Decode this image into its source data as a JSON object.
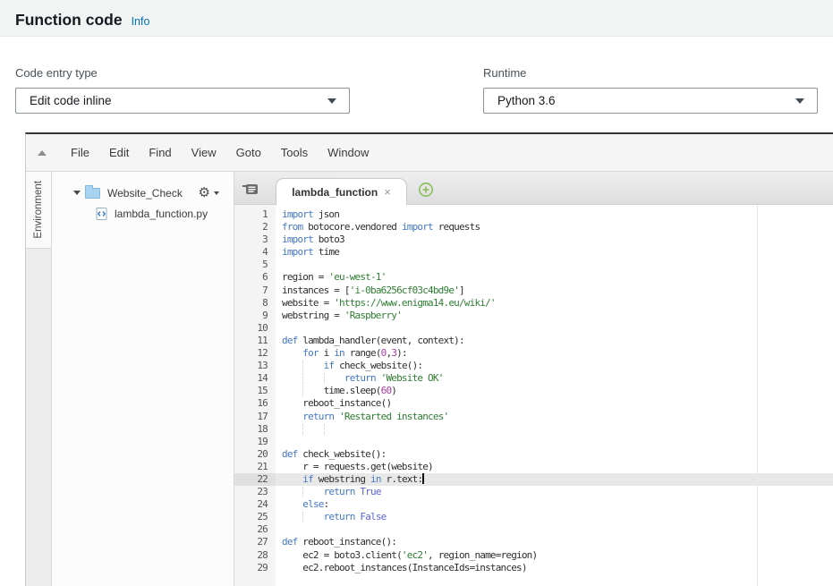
{
  "header": {
    "title": "Function code",
    "info": "Info"
  },
  "form": {
    "code_entry_label": "Code entry type",
    "code_entry_value": "Edit code inline",
    "runtime_label": "Runtime",
    "runtime_value": "Python 3.6"
  },
  "editor": {
    "menu": [
      "File",
      "Edit",
      "Find",
      "View",
      "Goto",
      "Tools",
      "Window"
    ],
    "sidebar_tab": "Environment",
    "tree": {
      "folder": "Website_Check",
      "file": "lambda_function.py"
    },
    "tab": {
      "title": "lambda_function",
      "close": "×"
    },
    "code": {
      "active_line": 22,
      "lines": [
        [
          [
            "k",
            "import"
          ],
          [
            "t",
            " json"
          ]
        ],
        [
          [
            "k",
            "from"
          ],
          [
            "t",
            " botocore.vendored "
          ],
          [
            "k",
            "import"
          ],
          [
            "t",
            " requests"
          ]
        ],
        [
          [
            "k",
            "import"
          ],
          [
            "t",
            " boto3"
          ]
        ],
        [
          [
            "k",
            "import"
          ],
          [
            "t",
            " time"
          ]
        ],
        [],
        [
          [
            "t",
            "region = "
          ],
          [
            "s",
            "'eu-west-1'"
          ]
        ],
        [
          [
            "t",
            "instances = ["
          ],
          [
            "s",
            "'i-0ba6256cf03c4bd9e'"
          ],
          [
            "t",
            "]"
          ]
        ],
        [
          [
            "t",
            "website = "
          ],
          [
            "s",
            "'https://www.enigma14.eu/wiki/'"
          ]
        ],
        [
          [
            "t",
            "webstring = "
          ],
          [
            "s",
            "'Raspberry'"
          ]
        ],
        [],
        [
          [
            "k",
            "def"
          ],
          [
            "t",
            " lambda_handler(event, context):"
          ]
        ],
        [
          [
            "t",
            "    "
          ],
          [
            "k",
            "for"
          ],
          [
            "t",
            " i "
          ],
          [
            "k",
            "in"
          ],
          [
            "t",
            " range("
          ],
          [
            "n",
            "0"
          ],
          [
            "t",
            ","
          ],
          [
            "n",
            "3"
          ],
          [
            "t",
            "):"
          ]
        ],
        [
          [
            "t",
            "        "
          ],
          [
            "k",
            "if"
          ],
          [
            "t",
            " check_website():"
          ]
        ],
        [
          [
            "t",
            "            "
          ],
          [
            "k",
            "return"
          ],
          [
            "t",
            " "
          ],
          [
            "s",
            "'Website OK'"
          ]
        ],
        [
          [
            "t",
            "        time.sleep("
          ],
          [
            "n",
            "60"
          ],
          [
            "t",
            ")"
          ]
        ],
        [
          [
            "t",
            "    reboot_instance()"
          ]
        ],
        [
          [
            "t",
            "    "
          ],
          [
            "k",
            "return"
          ],
          [
            "t",
            " "
          ],
          [
            "s",
            "'Restarted instances'"
          ]
        ],
        [
          [
            "t",
            "        "
          ]
        ],
        [],
        [
          [
            "k",
            "def"
          ],
          [
            "t",
            " check_website():"
          ]
        ],
        [
          [
            "t",
            "    r = requests.get(website)"
          ]
        ],
        [
          [
            "t",
            "    "
          ],
          [
            "k",
            "if"
          ],
          [
            "t",
            " webstring "
          ],
          [
            "k",
            "in"
          ],
          [
            "t",
            " r.text:"
          ]
        ],
        [
          [
            "t",
            "        "
          ],
          [
            "k",
            "return"
          ],
          [
            "t",
            " "
          ],
          [
            "c",
            "True"
          ]
        ],
        [
          [
            "t",
            "    "
          ],
          [
            "k",
            "else"
          ],
          [
            "t",
            ":"
          ]
        ],
        [
          [
            "t",
            "        "
          ],
          [
            "k",
            "return"
          ],
          [
            "t",
            " "
          ],
          [
            "c",
            "False"
          ]
        ],
        [],
        [
          [
            "k",
            "def"
          ],
          [
            "t",
            " reboot_instance():"
          ]
        ],
        [
          [
            "t",
            "    ec2 = boto3.client("
          ],
          [
            "s",
            "'ec2'"
          ],
          [
            "t",
            ", region_name=region)"
          ]
        ],
        [
          [
            "t",
            "    ec2.reboot_instances(InstanceIds=instances)"
          ]
        ]
      ]
    }
  },
  "colors": {
    "link": "#0073bb",
    "keyword": "#4377c4",
    "string": "#2f7d33",
    "number": "#a73ba2",
    "constant": "#5a64d6",
    "plain": "#2e2e2e",
    "plus_green": "#7db23f"
  }
}
